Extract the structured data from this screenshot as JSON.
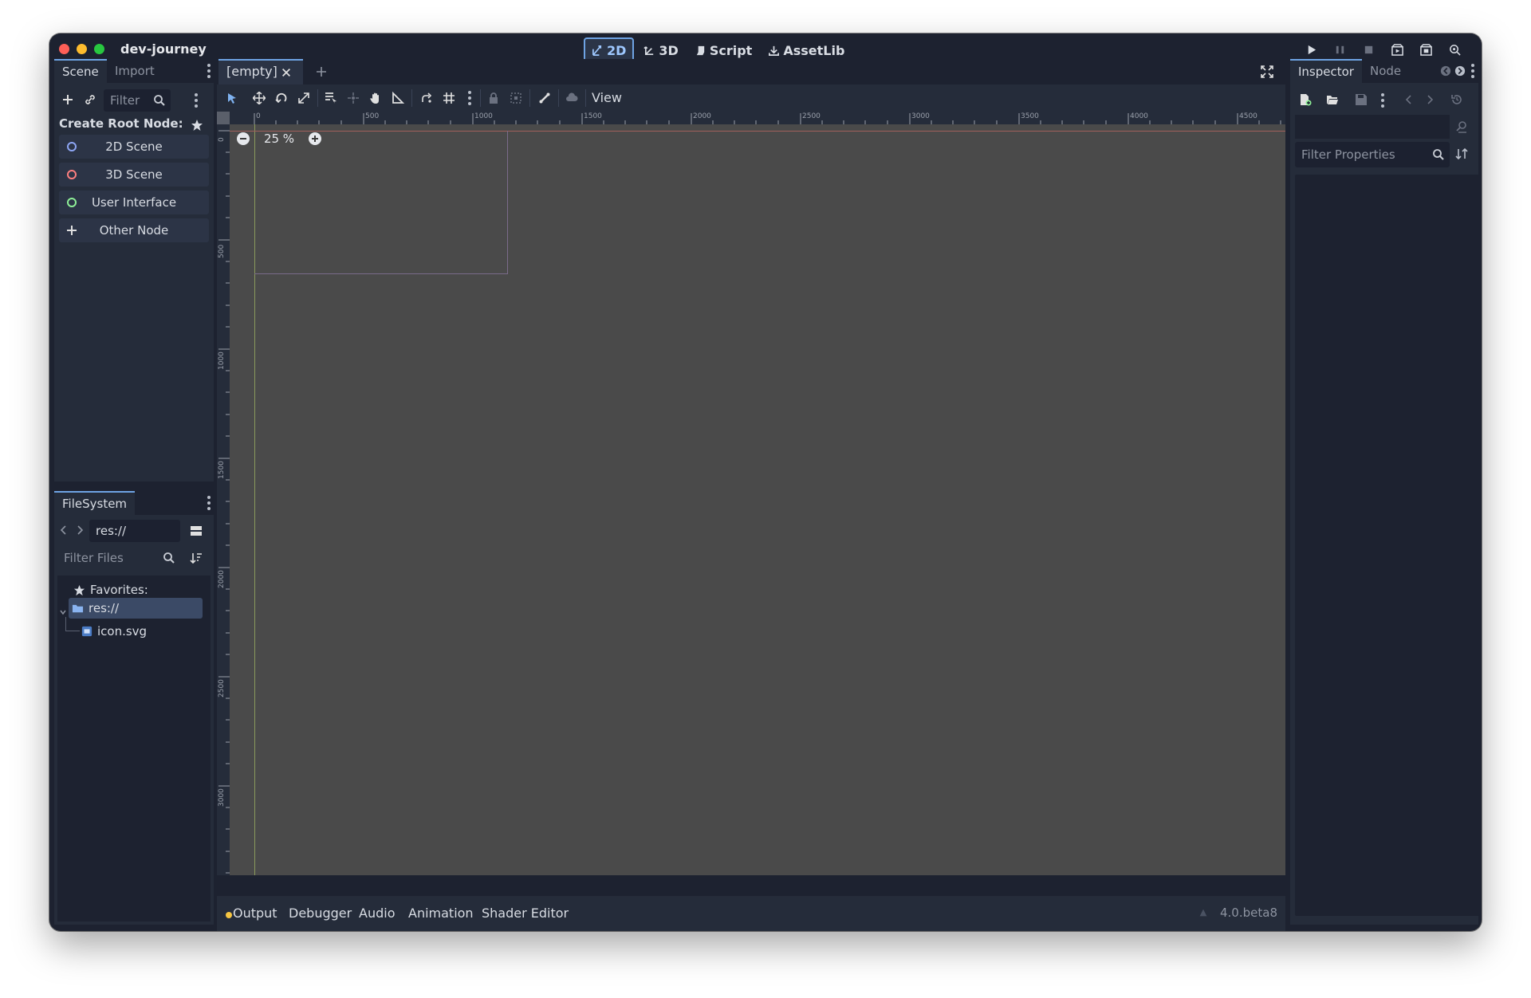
{
  "window": {
    "title": "dev-journey"
  },
  "main_tabs": [
    {
      "label": "2D",
      "active": true
    },
    {
      "label": "3D",
      "active": false
    },
    {
      "label": "Script",
      "active": false
    },
    {
      "label": "AssetLib",
      "active": false
    }
  ],
  "run_controls": [
    "play-icon",
    "pause-icon",
    "stop-icon",
    "play-scene-icon",
    "play-custom-scene-icon",
    "movie-maker-icon"
  ],
  "scene_panel": {
    "tabs": [
      "Scene",
      "Import"
    ],
    "filter_placeholder": "Filter",
    "create_root_label": "Create Root Node:",
    "root_options": [
      {
        "label": "2D Scene",
        "icon": "node2d-icon",
        "color": "#8da5f3"
      },
      {
        "label": "3D Scene",
        "icon": "node3d-icon",
        "color": "#fc7f7f"
      },
      {
        "label": "User Interface",
        "icon": "control-icon",
        "color": "#8eef97"
      },
      {
        "label": "Other Node",
        "icon": "add-icon",
        "color": "#e0e0e0"
      }
    ]
  },
  "filesystem": {
    "tab": "FileSystem",
    "path": "res://",
    "filter_placeholder": "Filter Files",
    "tree": {
      "favorites": "Favorites:",
      "root": "res://",
      "files": [
        "icon.svg"
      ]
    }
  },
  "editor": {
    "tab_label": "[empty]",
    "view_menu": "View",
    "zoom": "25 %",
    "ruler_x": [
      "0",
      "500",
      "1000",
      "1500",
      "2000",
      "2500",
      "3000",
      "3500",
      "4000",
      "4500"
    ],
    "ruler_y": [
      "0",
      "500",
      "1000",
      "1500",
      "2000",
      "2500",
      "3000"
    ]
  },
  "bottom_panel": {
    "items": [
      "Output",
      "Debugger",
      "Audio",
      "Animation",
      "Shader Editor"
    ],
    "version": "4.0.beta8"
  },
  "inspector": {
    "tabs": [
      "Inspector",
      "Node"
    ],
    "filter_placeholder": "Filter Properties"
  },
  "colors": {
    "accent": "#6ea3e3",
    "bg_dark": "#1d2230",
    "bg_panel": "#252c3a",
    "viewport": "#4a4a4a"
  }
}
